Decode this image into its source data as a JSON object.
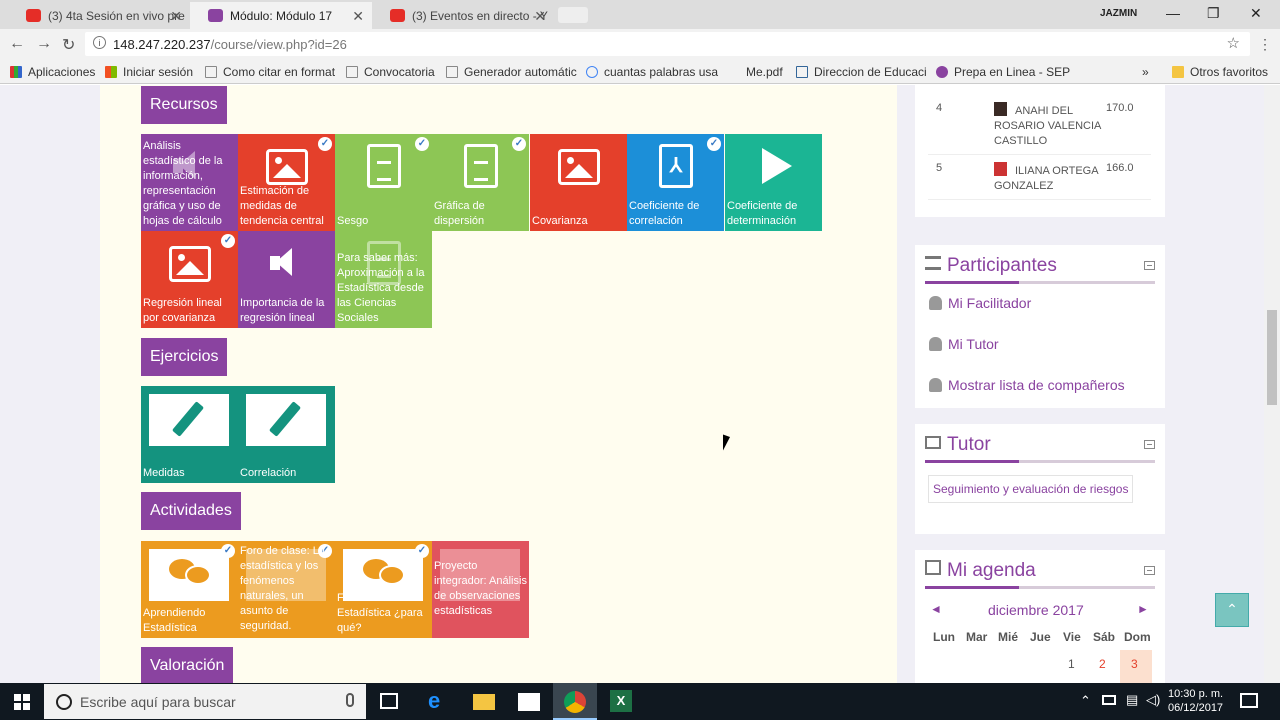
{
  "browser": {
    "tabs": [
      {
        "title": "(3) 4ta Sesión en vivo pre",
        "favicon_color": "#e52d27"
      },
      {
        "title": "Módulo: Módulo 17",
        "favicon_color": "#8a43a0"
      },
      {
        "title": "(3) Eventos en directo - Y",
        "favicon_color": "#e52d27"
      }
    ],
    "user_name": "JAZMIN",
    "url_host": "148.247.220.237",
    "url_path": "/course/view.php?id=26",
    "bookmarks": [
      "Aplicaciones",
      "Iniciar sesión",
      "Como citar en format",
      "Convocatoria",
      "Generador automátic",
      "cuantas palabras usa",
      "Me.pdf",
      "Direccion de Educaci",
      "Prepa en Linea - SEP"
    ],
    "more_bookmarks": "»",
    "other_favorites": "Otros favoritos"
  },
  "sections": {
    "recursos": "Recursos",
    "ejercicios": "Ejercicios",
    "actividades": "Actividades",
    "valoracion": "Valoración"
  },
  "recursos_tiles": [
    {
      "label": "Análisis estadístico de la información, representación gráfica y uso de hojas de cálculo",
      "color": "#8a43a0",
      "icon": "speaker-icon",
      "done": false
    },
    {
      "label": "Estimación de medidas de tendencia central",
      "color": "#e4402b",
      "icon": "image-icon",
      "done": true
    },
    {
      "label": "Sesgo",
      "color": "#8dc655",
      "icon": "document-icon",
      "done": true
    },
    {
      "label": "Gráfica de dispersión",
      "color": "#8dc655",
      "icon": "document-icon",
      "done": true
    },
    {
      "label": "Covarianza",
      "color": "#e4402b",
      "icon": "image-icon",
      "done": false
    },
    {
      "label": "Coeficiente de correlación",
      "color": "#1c8fd8",
      "icon": "pdf-icon",
      "done": true
    },
    {
      "label": "Coeficiente de determinación",
      "color": "#1bb594",
      "icon": "play-icon",
      "done": false
    },
    {
      "label": "Regresión lineal por covarianza",
      "color": "#e4402b",
      "icon": "image-icon",
      "done": true
    },
    {
      "label": "Importancia de la regresión lineal",
      "color": "#8a43a0",
      "icon": "speaker-icon",
      "done": false
    },
    {
      "label": "Para saber más: Aproximación a la Estadística desde las Ciencias Sociales",
      "color": "#8dc655",
      "icon": "document-icon",
      "done": false
    }
  ],
  "ejercicios_tiles": [
    {
      "label": "Medidas",
      "color": "#14937f",
      "icon": "pencil-icon"
    },
    {
      "label": "Correlación",
      "color": "#14937f",
      "icon": "pencil-icon"
    }
  ],
  "actividades_tiles": [
    {
      "label": "Aprendiendo Estadística",
      "color": "#ec9b1f",
      "icon": "chat-icon",
      "done": true
    },
    {
      "label": "Foro de clase: La estadística y los fenómenos naturales, un asunto de seguridad.",
      "color": "#ec9b1f",
      "icon": "chat-icon",
      "done": true
    },
    {
      "label": "Foro de debate: Estadística ¿para qué?",
      "color": "#ec9b1f",
      "icon": "chat-icon",
      "done": true
    },
    {
      "label": "Proyecto integrador: Análisis de observaciones estadísticas",
      "color": "#e0535e",
      "icon": "calendar-icon",
      "done": false
    }
  ],
  "ranking": [
    {
      "pos": "4",
      "name": "ANAHI DEL ROSARIO VALENCIA CASTILLO",
      "score": "170.0"
    },
    {
      "pos": "5",
      "name": "ILIANA ORTEGA GONZALEZ",
      "score": "166.0"
    }
  ],
  "participantes": {
    "title": "Participantes",
    "links": [
      "Mi Facilitador",
      "Mi Tutor",
      "Mostrar lista de compañeros"
    ]
  },
  "tutor": {
    "title": "Tutor",
    "button": "Seguimiento y evaluación de riesgos"
  },
  "agenda": {
    "title": "Mi agenda",
    "prev": "◄",
    "next": "►",
    "month": "diciembre 2017",
    "weekdays": [
      "Lun",
      "Mar",
      "Mié",
      "Jue",
      "Vie",
      "Sáb",
      "Dom"
    ],
    "days": [
      "1",
      "2",
      "3"
    ]
  },
  "taskbar": {
    "search_placeholder": "Escribe aquí para buscar",
    "time": "10:30 p. m.",
    "date": "06/12/2017"
  }
}
